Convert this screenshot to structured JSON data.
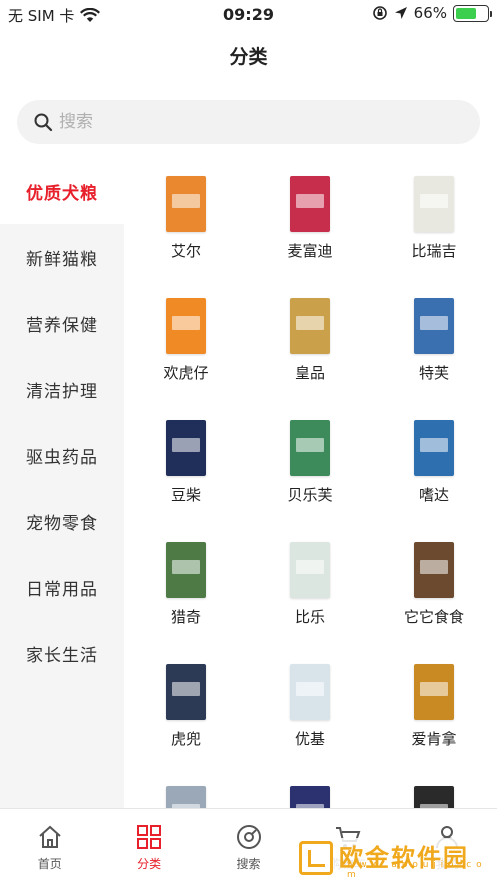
{
  "status_bar": {
    "carrier": "无 SIM 卡",
    "time": "09:29",
    "battery": "66%",
    "battery_level": 0.66
  },
  "header": {
    "title": "分类"
  },
  "search": {
    "placeholder": "搜索"
  },
  "sidebar": {
    "items": [
      {
        "label": "优质犬粮",
        "active": true
      },
      {
        "label": "新鲜猫粮",
        "active": false
      },
      {
        "label": "营养保健",
        "active": false
      },
      {
        "label": "清洁护理",
        "active": false
      },
      {
        "label": "驱虫药品",
        "active": false
      },
      {
        "label": "宠物零食",
        "active": false
      },
      {
        "label": "日常用品",
        "active": false
      },
      {
        "label": "家长生活",
        "active": false
      }
    ]
  },
  "products": [
    {
      "name": "艾尔",
      "color": "#e9882e"
    },
    {
      "name": "麦富迪",
      "color": "#c72e4c"
    },
    {
      "name": "比瑞吉",
      "color": "#e8e8e0"
    },
    {
      "name": "欢虎仔",
      "color": "#f08a24"
    },
    {
      "name": "皇品",
      "color": "#caa04a"
    },
    {
      "name": "特芙",
      "color": "#3a6fb0"
    },
    {
      "name": "豆柴",
      "color": "#1f2f5a"
    },
    {
      "name": "贝乐芙",
      "color": "#3d8a5a"
    },
    {
      "name": "嗜达",
      "color": "#2e6fb0"
    },
    {
      "name": "猎奇",
      "color": "#4d7a45"
    },
    {
      "name": "比乐",
      "color": "#dbe6e0"
    },
    {
      "name": "它它食食",
      "color": "#6b4a2f"
    },
    {
      "name": "虎兜",
      "color": "#2c3a55"
    },
    {
      "name": "优基",
      "color": "#d8e4ea"
    },
    {
      "name": "爱肯拿",
      "color": "#c98a24"
    },
    {
      "name": "",
      "color": "#9aa8b8"
    },
    {
      "name": "",
      "color": "#2c3270"
    },
    {
      "name": "",
      "color": "#2a2a2a"
    }
  ],
  "tab_bar": {
    "tabs": [
      {
        "label": "首页",
        "icon": "home-icon",
        "active": false
      },
      {
        "label": "分类",
        "icon": "category-grid-icon",
        "active": true
      },
      {
        "label": "搜索",
        "icon": "discover-icon",
        "active": false
      },
      {
        "label": "购物车",
        "icon": "cart-icon",
        "active": false
      },
      {
        "label": "我的",
        "icon": "profile-icon",
        "active": false
      }
    ]
  },
  "watermark": {
    "text": "欧金软件园",
    "url": "w w w . a p o u j i n . c o m"
  },
  "colors": {
    "accent": "#e7202c",
    "sidebar_bg": "#f5f5f5",
    "battery": "#3ccf4e",
    "watermark": "#f0a81c"
  }
}
